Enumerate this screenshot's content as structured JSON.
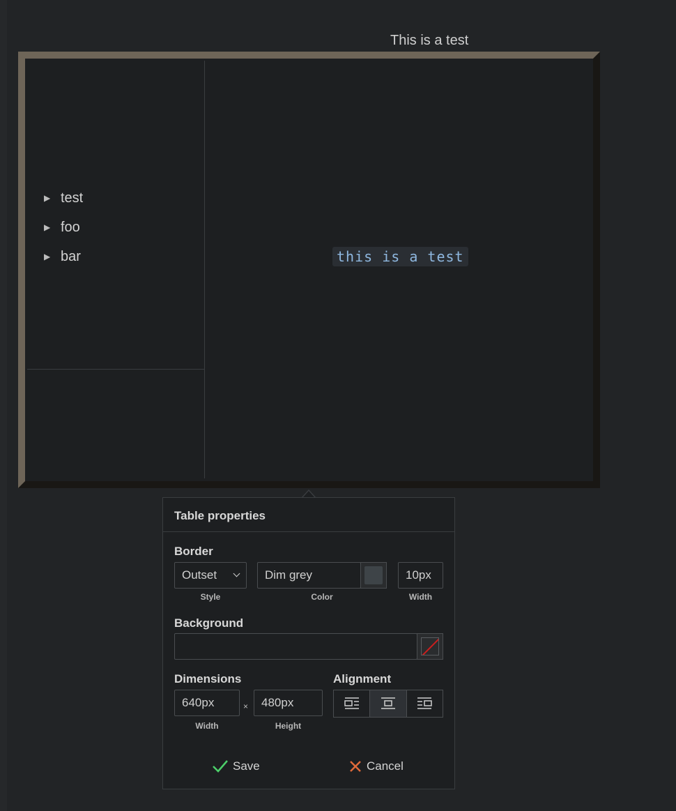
{
  "caption": "This is a test",
  "tree_items": [
    "test",
    "foo",
    "bar"
  ],
  "code_text": "this is a test",
  "panel": {
    "title": "Table properties",
    "border": {
      "section_label": "Border",
      "style_value": "Outset",
      "style_label": "Style",
      "color_value": "Dim grey",
      "color_label": "Color",
      "width_value": "10px",
      "width_label": "Width"
    },
    "background": {
      "section_label": "Background",
      "value": ""
    },
    "dimensions": {
      "section_label": "Dimensions",
      "width_value": "640px",
      "width_label": "Width",
      "times": "×",
      "height_value": "480px",
      "height_label": "Height"
    },
    "alignment": {
      "section_label": "Alignment",
      "options": [
        "align-left",
        "align-center",
        "align-right"
      ],
      "selected": "align-center"
    },
    "save_label": "Save",
    "cancel_label": "Cancel"
  },
  "colors": {
    "border_color": "#6e6558",
    "code_text_color": "#8fb8e0",
    "save_icon_color": "#4cd06a",
    "cancel_icon_color": "#e06a3a"
  }
}
